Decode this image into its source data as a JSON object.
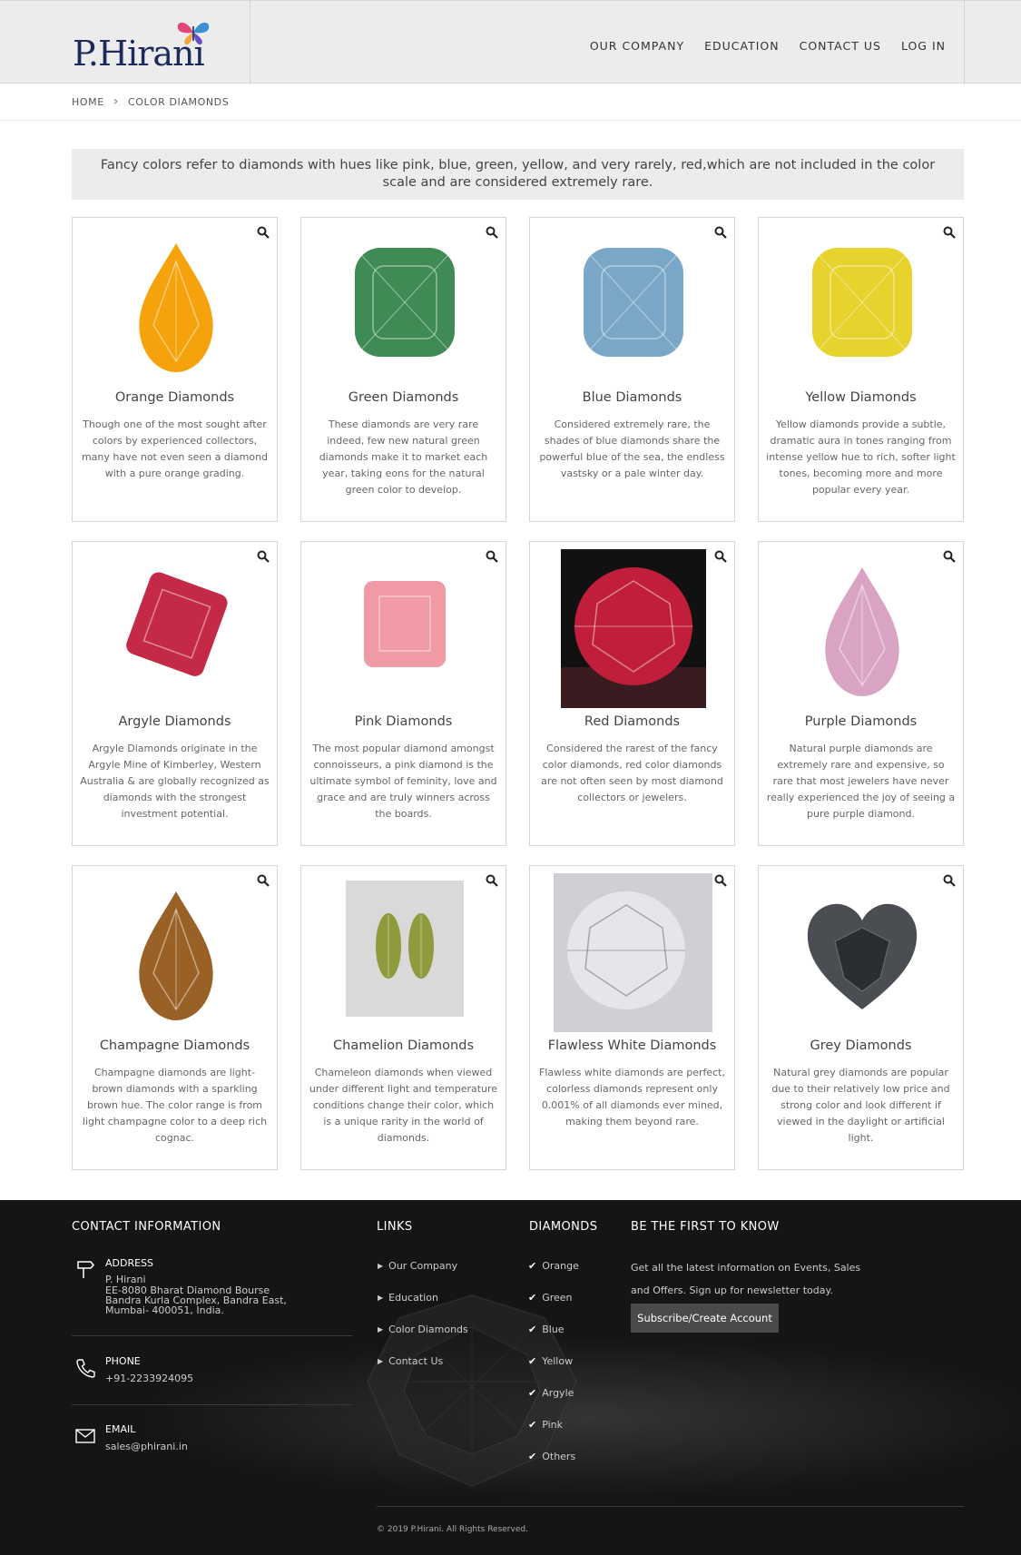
{
  "header": {
    "logo_text": "P.Hirani",
    "nav": [
      "OUR COMPANY",
      "EDUCATION",
      "CONTACT US",
      "LOG IN"
    ]
  },
  "breadcrumb": {
    "home": "HOME",
    "current": "COLOR DIAMONDS"
  },
  "intro": "Fancy colors refer to diamonds with hues like pink, blue, green, yellow, and very rarely, red,which are not included in the color scale and are considered extremely rare.",
  "cards": [
    {
      "title": "Orange Diamonds",
      "desc": "Though one of the most sought after colors by experienced collectors, many have not even seen a diamond with a pure orange grading.",
      "color": "#f5a20c"
    },
    {
      "title": "Green Diamonds",
      "desc": "These diamonds are very rare indeed, few new natural green diamonds make it to market each year, taking eons for the natural green color to develop.",
      "color": "#3f8a55"
    },
    {
      "title": "Blue Diamonds",
      "desc": "Considered extremely rare, the shades of blue diamonds share the powerful blue of the sea, the endless vastsky or a pale winter day.",
      "color": "#7aa7c7"
    },
    {
      "title": "Yellow Diamonds",
      "desc": "Yellow diamonds provide a subtle, dramatic aura in tones ranging from intense yellow hue to rich, softer light tones, becoming more and more popular every year.",
      "color": "#e8d22e"
    },
    {
      "title": "Argyle Diamonds",
      "desc": "Argyle Diamonds originate in the Argyle Mine of Kimberley, Western Australia & are globally recognized as diamonds with the strongest investment potential.",
      "color": "#c42a48"
    },
    {
      "title": "Pink Diamonds",
      "desc": "The most popular diamond amongst connoisseurs, a pink diamond is the ultimate symbol of feminity, love and grace and are truly winners across the boards.",
      "color": "#f09aa6"
    },
    {
      "title": "Red Diamonds",
      "desc": "Considered the rarest of the fancy color diamonds, red color diamonds are not often seen by most diamond collectors or jewelers.",
      "color": "#c01e3a"
    },
    {
      "title": "Purple Diamonds",
      "desc": "Natural purple diamonds are extremely rare and expensive, so rare that most jewelers have never really experienced the joy of seeing a pure purple diamond.",
      "color": "#d9a4c4"
    },
    {
      "title": "Champagne Diamonds",
      "desc": "Champagne diamonds are light-brown diamonds with a sparkling brown hue. The color range is from light champagne color to a deep rich cognac.",
      "color": "#9a6126"
    },
    {
      "title": "Chamelion Diamonds",
      "desc": "Chameleon diamonds when viewed under different light and temperature conditions change their color, which is a unique rarity in the world of diamonds.",
      "color": "#8e9a3c"
    },
    {
      "title": "Flawless White Diamonds",
      "desc": "Flawless white diamonds are perfect, colorless diamonds represent only 0.001% of all diamonds ever mined, making them beyond rare.",
      "color": "#e6e6ea"
    },
    {
      "title": "Grey Diamonds",
      "desc": "Natural grey diamonds are popular due to their relatively low price and strong color and look different if viewed in the daylight or artificial light.",
      "color": "#4a4e52"
    }
  ],
  "footer": {
    "contact_heading": "CONTACT INFORMATION",
    "address_label": "ADDRESS",
    "address_lines": [
      "P. Hirani",
      "EE-8080 Bharat Diamond Bourse",
      "Bandra Kurla Complex, Bandra East,",
      "Mumbai- 400051, India."
    ],
    "phone_label": "PHONE",
    "phone": "+91-2233924095",
    "email_label": "EMAIL",
    "email": "sales@phirani.in",
    "links_heading": "LINKS",
    "links": [
      "Our Company",
      "Education",
      "Color Diamonds",
      "Contact Us"
    ],
    "diamonds_heading": "DIAMONDS",
    "diamonds": [
      "Orange",
      "Green",
      "Blue",
      "Yellow",
      "Argyle",
      "Pink",
      "Others"
    ],
    "news_heading": "BE THE FIRST TO KNOW",
    "news_text": "Get all the latest information on Events, Sales and Offers. Sign up for newsletter today.",
    "subscribe_label": "Subscribe/Create Account",
    "copyright": "© 2019 P.Hirani. All Rights Reserved."
  }
}
